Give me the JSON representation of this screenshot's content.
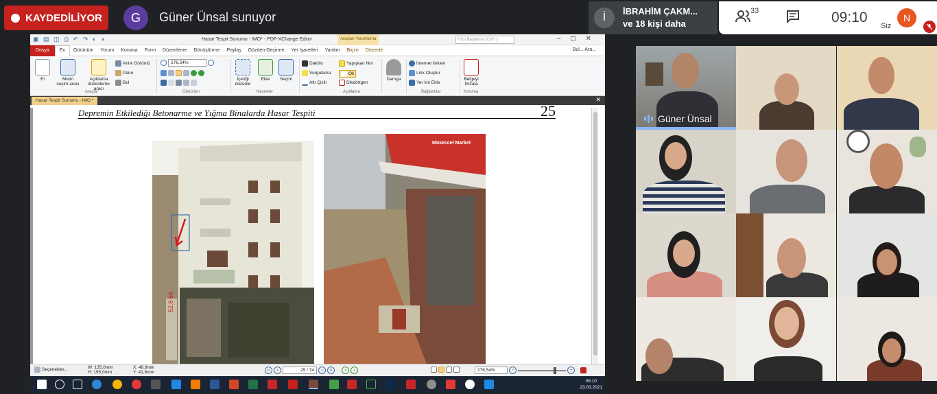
{
  "meet": {
    "recording_label": "KAYDEDİLİYOR",
    "presenter_initial": "G",
    "presenter_text": "Güner Ünsal sunuyor",
    "participant_initial": "İ",
    "participant_name": "İBRAHİM ÇAKM...",
    "participant_more": "ve 18 kişi daha",
    "people_count": "33",
    "time": "09:10",
    "self_initial": "N",
    "self_label": "Siz",
    "accent_red": "#c5221f",
    "speaker_name": "Güner Ünsal"
  },
  "app": {
    "window_title": "Hasar Tespit Sunumu - IMO* - PDF-XChange Editor",
    "context_tab": "Araçları Yorumlama",
    "search_placeholder": "Hızlı Başlatma (Ctrl+.)",
    "menu": [
      "Dosya",
      "Ev",
      "Görünüm",
      "Yorum",
      "Koruma",
      "Form",
      "Düzenleme",
      "Dönüştürme",
      "Paylaş",
      "Gözden Geçirme",
      "Yer İşaretleri",
      "Yardım",
      "Biçim",
      "Düzenle"
    ],
    "menu_right": "Bul...   Ara...",
    "ribbon": {
      "el": "El",
      "metin": "Metin",
      "secim_araci": "seçim aracı",
      "aciklama": "Açıklama",
      "duzenleme_araci": "düzenleme aracı",
      "anlik_goruntu": "Anlık Görüntü",
      "pano": "Pano",
      "bul": "Bul",
      "araclar": "Araçlar",
      "zoom": "276,54%",
      "gorunum": "Görünüm",
      "icerigi_duzenle": "İçeriği düzenle",
      "ekle": "Ekle",
      "secim": "Seçim",
      "nesneler": "Nesneler",
      "daktilo": "Daktilo",
      "vurgulama": "Vurgulama",
      "alti_cizili": "Altı Çizili",
      "yapiskan_not": "Yapışkan Not",
      "ok": "Ok",
      "dikdortgen": "Dikdörtgen",
      "aciklama_group": "Açıklama",
      "damga": "Damga",
      "internet_linkleri": "İnternet linkleri",
      "link_olustur": "Link Oluştur",
      "yer_imi_ekle": "Yer İmi Ekle",
      "baglantilar": "Bağlantılar",
      "belgeyi_imzala": "Belgeyi İmzala",
      "koruma": "Koruma"
    },
    "doc_tab": "Hasar Tespit Sunumu - IMO *",
    "page_title": "Depremin Etkilediği Betonarme ve Yığma Binalarda Hasar Tespiti",
    "page_number_label": "25",
    "photo_caption_sign": "Müsecceł Market",
    "photo_sidebar_text": "52.8 66",
    "status": {
      "selector": "Seçenekler...",
      "w": "W: 135,0mm",
      "h": "H: 195,0mm",
      "x": "X: 48,9mm",
      "y": "Y: 41,6mm",
      "page_counter": "25 / 74",
      "zoom": "276,54%"
    },
    "taskbar_time": "09:10",
    "taskbar_date": "23.03.2021"
  }
}
